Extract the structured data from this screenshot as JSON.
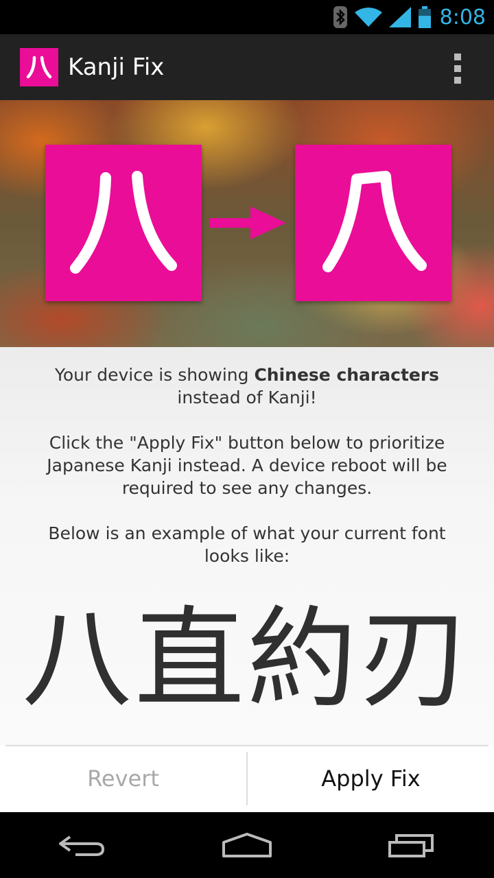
{
  "status_bar": {
    "time": "8:08",
    "icons": [
      "bluetooth-icon",
      "wifi-icon",
      "signal-icon",
      "battery-icon"
    ]
  },
  "action_bar": {
    "title": "Kanji Fix",
    "app_icon_glyph": "八",
    "menu_icon": "overflow-menu-icon"
  },
  "hero": {
    "from_glyph": "八",
    "to_glyph": "八",
    "arrow_icon": "arrow-right-icon"
  },
  "message": {
    "line1_pre": "Your device is showing ",
    "line1_bold": "Chinese characters",
    "line1_post": " instead of Kanji!",
    "line2": "Click the \"Apply Fix\" button below to prioritize Japanese Kanji instead. A device reboot will be required to see any changes.",
    "line3": "Below is an example of what your current font looks like:"
  },
  "sample_font": {
    "text": "八直約刃"
  },
  "buttons": {
    "revert": "Revert",
    "apply": "Apply Fix"
  },
  "colors": {
    "accent": "#ea0d97",
    "status_time": "#33b5e5",
    "action_bar": "#222222"
  },
  "nav_bar": {
    "back": "back-icon",
    "home": "home-icon",
    "recents": "recents-icon"
  }
}
